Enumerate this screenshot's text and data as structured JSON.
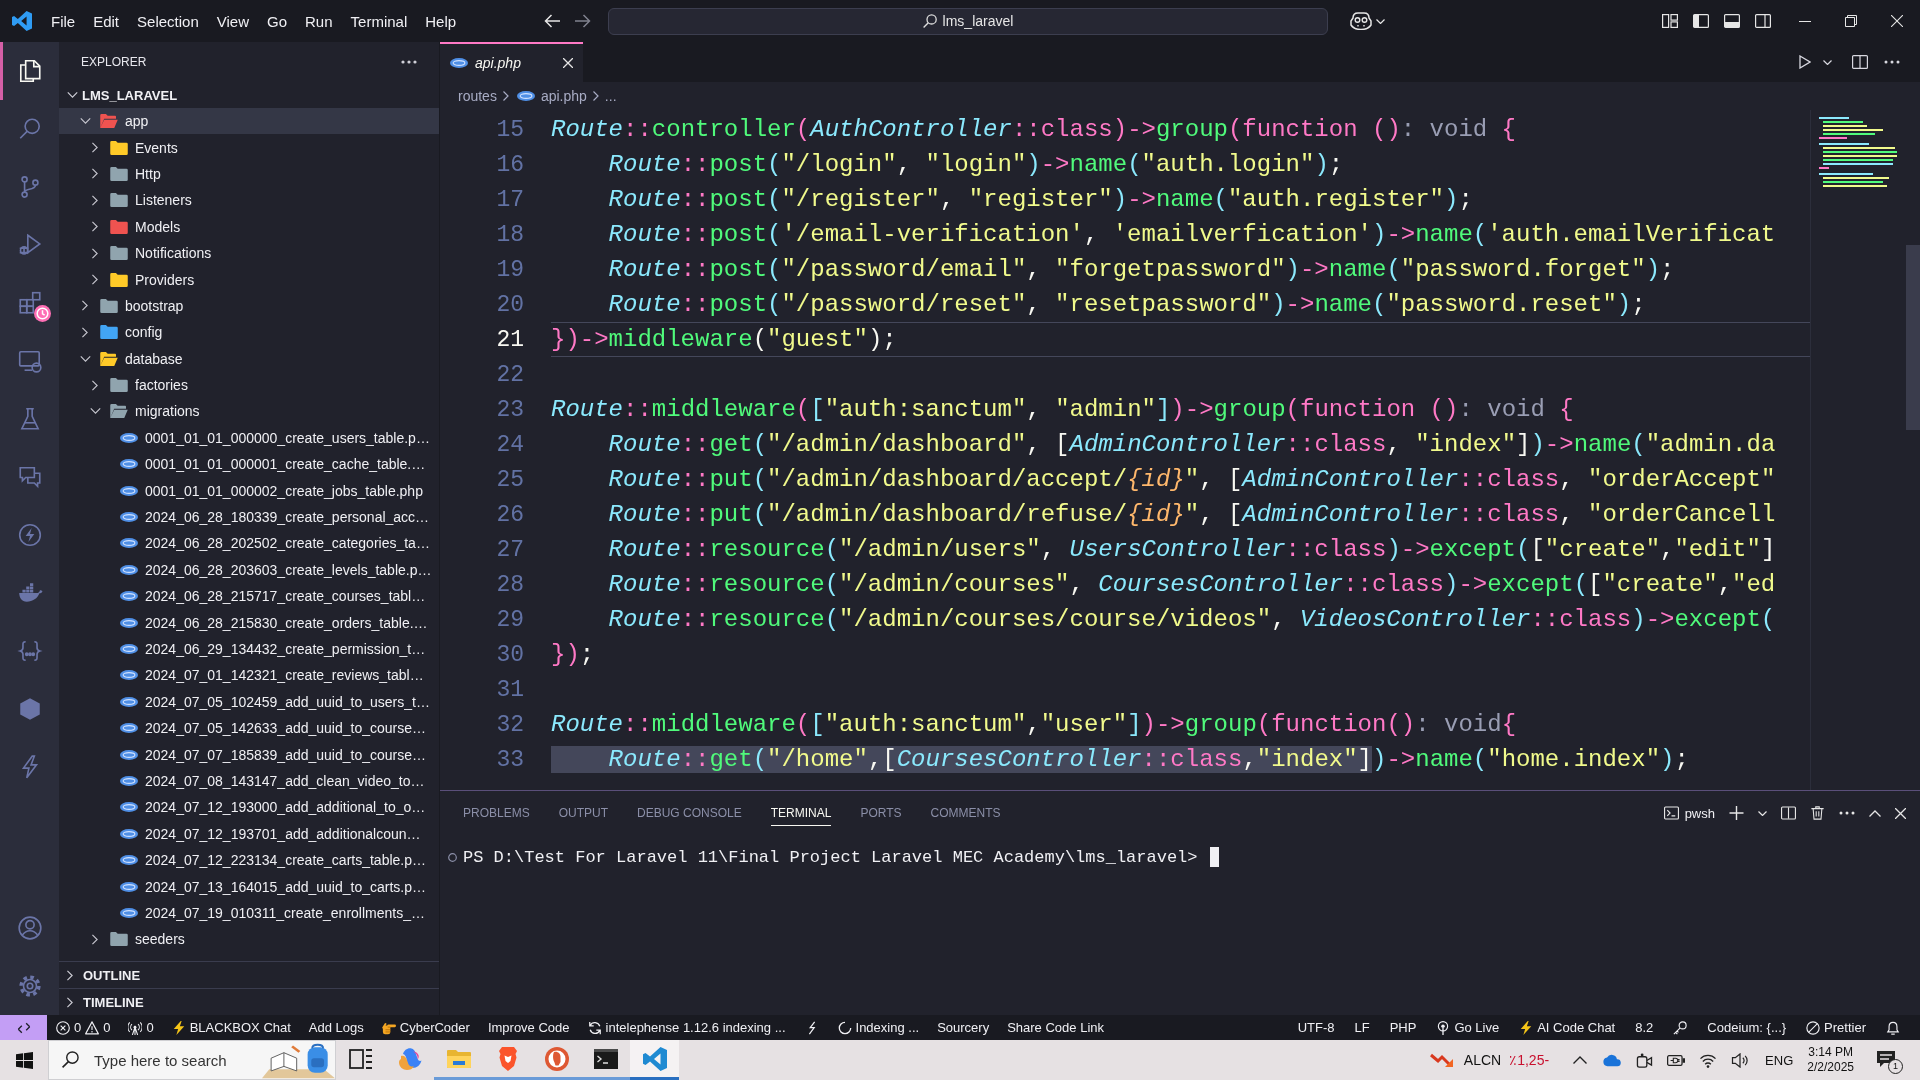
{
  "title_bar": {
    "menu": [
      "File",
      "Edit",
      "Selection",
      "View",
      "Go",
      "Run",
      "Terminal",
      "Help"
    ],
    "search": "lms_laravel",
    "layout_toggles": [
      {
        "kind": "primary-sidebar",
        "on": true
      },
      {
        "kind": "panel",
        "on": true
      },
      {
        "kind": "secondary-sidebar",
        "on": false
      }
    ]
  },
  "activity_bar": {
    "top": [
      {
        "kind": "explorer",
        "selected": true,
        "badge": false
      },
      {
        "kind": "search",
        "selected": false,
        "badge": false
      },
      {
        "kind": "source-control",
        "selected": false,
        "badge": false
      },
      {
        "kind": "run-debug",
        "selected": false,
        "badge": false
      },
      {
        "kind": "extensions",
        "selected": false,
        "badge": true
      },
      {
        "kind": "remote",
        "selected": false,
        "badge": false
      },
      {
        "kind": "testing",
        "selected": false,
        "badge": false
      },
      {
        "kind": "chat",
        "selected": false,
        "badge": false
      },
      {
        "kind": "bolt-circle",
        "selected": false,
        "badge": false
      },
      {
        "kind": "docker",
        "selected": false,
        "badge": false
      },
      {
        "kind": "braces",
        "selected": false,
        "badge": false
      },
      {
        "kind": "hexagon",
        "selected": false,
        "badge": false
      },
      {
        "kind": "bolt",
        "selected": false,
        "badge": false
      }
    ],
    "bottom": [
      {
        "kind": "account"
      },
      {
        "kind": "settings"
      }
    ]
  },
  "sidebar": {
    "title": "EXPLORER",
    "root": {
      "label": "LMS_LARAVEL",
      "expanded": true,
      "children": [
        {
          "label": "app",
          "kind": "folder",
          "color": "#ef5350",
          "expanded": true,
          "selected": true,
          "children": [
            {
              "label": "Events",
              "kind": "folder",
              "color": "#ffca28",
              "expanded": false,
              "selected": false
            },
            {
              "label": "Http",
              "kind": "folder",
              "color": "#90a4ae",
              "expanded": false,
              "selected": false
            },
            {
              "label": "Listeners",
              "kind": "folder",
              "color": "#90a4ae",
              "expanded": false,
              "selected": false
            },
            {
              "label": "Models",
              "kind": "folder",
              "color": "#ef5350",
              "expanded": false,
              "selected": false
            },
            {
              "label": "Notifications",
              "kind": "folder",
              "color": "#90a4ae",
              "expanded": false,
              "selected": false
            },
            {
              "label": "Providers",
              "kind": "folder",
              "color": "#ffca28",
              "expanded": false,
              "selected": false
            }
          ]
        },
        {
          "label": "bootstrap",
          "kind": "folder",
          "color": "#90a4ae",
          "expanded": false,
          "selected": false
        },
        {
          "label": "config",
          "kind": "folder",
          "color": "#42a5f5",
          "expanded": false,
          "selected": false
        },
        {
          "label": "database",
          "kind": "folder",
          "color": "#ffca28",
          "expanded": true,
          "selected": false,
          "children": [
            {
              "label": "factories",
              "kind": "folder",
              "color": "#90a4ae",
              "expanded": false,
              "selected": false
            },
            {
              "label": "migrations",
              "kind": "folder",
              "color": "#90a4ae",
              "expanded": true,
              "selected": false,
              "children": [
                {
                  "label": "0001_01_01_000000_create_users_table.p…",
                  "kind": "php",
                  "selected": false
                },
                {
                  "label": "0001_01_01_000001_create_cache_table.…",
                  "kind": "php",
                  "selected": false
                },
                {
                  "label": "0001_01_01_000002_create_jobs_table.php",
                  "kind": "php",
                  "selected": false
                },
                {
                  "label": "2024_06_28_180339_create_personal_acc…",
                  "kind": "php",
                  "selected": false
                },
                {
                  "label": "2024_06_28_202502_create_categories_ta…",
                  "kind": "php",
                  "selected": false
                },
                {
                  "label": "2024_06_28_203603_create_levels_table.p…",
                  "kind": "php",
                  "selected": false
                },
                {
                  "label": "2024_06_28_215717_create_courses_tabl…",
                  "kind": "php",
                  "selected": false
                },
                {
                  "label": "2024_06_28_215830_create_orders_table.…",
                  "kind": "php",
                  "selected": false
                },
                {
                  "label": "2024_06_29_134432_create_permission_t…",
                  "kind": "php",
                  "selected": false
                },
                {
                  "label": "2024_07_01_142321_create_reviews_tabl…",
                  "kind": "php",
                  "selected": false
                },
                {
                  "label": "2024_07_05_102459_add_uuid_to_users_t…",
                  "kind": "php",
                  "selected": false
                },
                {
                  "label": "2024_07_05_142633_add_uuid_to_course…",
                  "kind": "php",
                  "selected": false
                },
                {
                  "label": "2024_07_07_185839_add_uuid_to_course…",
                  "kind": "php",
                  "selected": false
                },
                {
                  "label": "2024_07_08_143147_add_clean_video_to…",
                  "kind": "php",
                  "selected": false
                },
                {
                  "label": "2024_07_12_193000_add_additional_to_o…",
                  "kind": "php",
                  "selected": false
                },
                {
                  "label": "2024_07_12_193701_add_additionalcoun…",
                  "kind": "php",
                  "selected": false
                },
                {
                  "label": "2024_07_12_223134_create_carts_table.p…",
                  "kind": "php",
                  "selected": false
                },
                {
                  "label": "2024_07_13_164015_add_uuid_to_carts.p…",
                  "kind": "php",
                  "selected": false
                },
                {
                  "label": "2024_07_19_010311_create_enrollments_…",
                  "kind": "php",
                  "selected": false
                }
              ]
            },
            {
              "label": "seeders",
              "kind": "folder",
              "color": "#90a4ae",
              "expanded": false,
              "selected": false
            }
          ]
        }
      ]
    },
    "sections": [
      {
        "label": "OUTLINE",
        "expanded": false
      },
      {
        "label": "TIMELINE",
        "expanded": false
      }
    ]
  },
  "editor": {
    "tabs": [
      {
        "label": "api.php",
        "selected": true,
        "preview": true
      }
    ],
    "breadcrumb": [
      {
        "label": "routes",
        "kind": "folder"
      },
      {
        "label": "api.php",
        "kind": "php"
      },
      {
        "label": "...",
        "kind": "more"
      }
    ],
    "lines": [
      {
        "number": "15",
        "current": false,
        "tokens": [
          {
            "text": "Route",
            "kind": "class"
          },
          {
            "text": "::",
            "kind": "keyword"
          },
          {
            "text": "controller",
            "kind": "function"
          },
          {
            "text": "(",
            "kind": "keyword"
          },
          {
            "text": "AuthController",
            "kind": "class"
          },
          {
            "text": "::class)->",
            "kind": "keyword"
          },
          {
            "text": "group",
            "kind": "function"
          },
          {
            "text": "(function ()",
            "kind": "keyword"
          },
          {
            "text": ": void ",
            "kind": "type"
          },
          {
            "text": "{",
            "kind": "keyword"
          }
        ]
      },
      {
        "number": "16",
        "current": false,
        "tokens": [
          {
            "text": "    Route",
            "kind": "class"
          },
          {
            "text": "::",
            "kind": "keyword"
          },
          {
            "text": "post",
            "kind": "function"
          },
          {
            "text": "(",
            "kind": "bracket"
          },
          {
            "text": "\"/login\"",
            "kind": "string"
          },
          {
            "text": ", ",
            "kind": "plain"
          },
          {
            "text": "\"login\"",
            "kind": "string"
          },
          {
            "text": ")",
            "kind": "bracket"
          },
          {
            "text": "->",
            "kind": "keyword"
          },
          {
            "text": "name",
            "kind": "function"
          },
          {
            "text": "(",
            "kind": "bracket"
          },
          {
            "text": "\"auth.login\"",
            "kind": "string"
          },
          {
            "text": ")",
            "kind": "bracket"
          },
          {
            "text": ";",
            "kind": "plain"
          }
        ]
      },
      {
        "number": "17",
        "current": false,
        "tokens": [
          {
            "text": "    Route",
            "kind": "class"
          },
          {
            "text": "::",
            "kind": "keyword"
          },
          {
            "text": "post",
            "kind": "function"
          },
          {
            "text": "(",
            "kind": "bracket"
          },
          {
            "text": "\"/register\"",
            "kind": "string"
          },
          {
            "text": ", ",
            "kind": "plain"
          },
          {
            "text": "\"register\"",
            "kind": "string"
          },
          {
            "text": ")",
            "kind": "bracket"
          },
          {
            "text": "->",
            "kind": "keyword"
          },
          {
            "text": "name",
            "kind": "function"
          },
          {
            "text": "(",
            "kind": "bracket"
          },
          {
            "text": "\"auth.register\"",
            "kind": "string"
          },
          {
            "text": ")",
            "kind": "bracket"
          },
          {
            "text": ";",
            "kind": "plain"
          }
        ]
      },
      {
        "number": "18",
        "current": false,
        "tokens": [
          {
            "text": "    Route",
            "kind": "class"
          },
          {
            "text": "::",
            "kind": "keyword"
          },
          {
            "text": "post",
            "kind": "function"
          },
          {
            "text": "(",
            "kind": "bracket"
          },
          {
            "text": "'/email-verification'",
            "kind": "string"
          },
          {
            "text": ", ",
            "kind": "plain"
          },
          {
            "text": "'emailverfication'",
            "kind": "string"
          },
          {
            "text": ")",
            "kind": "bracket"
          },
          {
            "text": "->",
            "kind": "keyword"
          },
          {
            "text": "name",
            "kind": "function"
          },
          {
            "text": "(",
            "kind": "bracket"
          },
          {
            "text": "'auth.emailVerificat",
            "kind": "string"
          }
        ]
      },
      {
        "number": "19",
        "current": false,
        "tokens": [
          {
            "text": "    Route",
            "kind": "class"
          },
          {
            "text": "::",
            "kind": "keyword"
          },
          {
            "text": "post",
            "kind": "function"
          },
          {
            "text": "(",
            "kind": "bracket"
          },
          {
            "text": "\"/password/email\"",
            "kind": "string"
          },
          {
            "text": ", ",
            "kind": "plain"
          },
          {
            "text": "\"forgetpassword\"",
            "kind": "string"
          },
          {
            "text": ")",
            "kind": "bracket"
          },
          {
            "text": "->",
            "kind": "keyword"
          },
          {
            "text": "name",
            "kind": "function"
          },
          {
            "text": "(",
            "kind": "bracket"
          },
          {
            "text": "\"password.forget\"",
            "kind": "string"
          },
          {
            "text": ")",
            "kind": "bracket"
          },
          {
            "text": ";",
            "kind": "plain"
          }
        ]
      },
      {
        "number": "20",
        "current": false,
        "tokens": [
          {
            "text": "    Route",
            "kind": "class"
          },
          {
            "text": "::",
            "kind": "keyword"
          },
          {
            "text": "post",
            "kind": "function"
          },
          {
            "text": "(",
            "kind": "bracket"
          },
          {
            "text": "\"/password/reset\"",
            "kind": "string"
          },
          {
            "text": ", ",
            "kind": "plain"
          },
          {
            "text": "\"resetpassword\"",
            "kind": "string"
          },
          {
            "text": ")",
            "kind": "bracket"
          },
          {
            "text": "->",
            "kind": "keyword"
          },
          {
            "text": "name",
            "kind": "function"
          },
          {
            "text": "(",
            "kind": "bracket"
          },
          {
            "text": "\"password.reset\"",
            "kind": "string"
          },
          {
            "text": ")",
            "kind": "bracket"
          },
          {
            "text": ";",
            "kind": "plain"
          }
        ]
      },
      {
        "number": "21",
        "current": true,
        "tokens": [
          {
            "text": "})->",
            "kind": "keyword"
          },
          {
            "text": "middleware",
            "kind": "function"
          },
          {
            "text": "(",
            "kind": "plain"
          },
          {
            "text": "\"guest\"",
            "kind": "string"
          },
          {
            "text": ");",
            "kind": "plain"
          }
        ]
      },
      {
        "number": "22",
        "current": false
      },
      {
        "number": "23",
        "current": false,
        "tokens": [
          {
            "text": "Route",
            "kind": "class"
          },
          {
            "text": "::",
            "kind": "keyword"
          },
          {
            "text": "middleware",
            "kind": "function"
          },
          {
            "text": "(",
            "kind": "keyword"
          },
          {
            "text": "[",
            "kind": "bracket"
          },
          {
            "text": "\"auth:sanctum\"",
            "kind": "string"
          },
          {
            "text": ", ",
            "kind": "plain"
          },
          {
            "text": "\"admin\"",
            "kind": "string"
          },
          {
            "text": "]",
            "kind": "bracket"
          },
          {
            "text": ")->",
            "kind": "keyword"
          },
          {
            "text": "group",
            "kind": "function"
          },
          {
            "text": "(function ()",
            "kind": "keyword"
          },
          {
            "text": ": void ",
            "kind": "type"
          },
          {
            "text": "{",
            "kind": "keyword"
          }
        ]
      },
      {
        "number": "24",
        "current": false,
        "tokens": [
          {
            "text": "    Route",
            "kind": "class"
          },
          {
            "text": "::",
            "kind": "keyword"
          },
          {
            "text": "get",
            "kind": "function"
          },
          {
            "text": "(",
            "kind": "bracket"
          },
          {
            "text": "\"/admin/dashboard\"",
            "kind": "string"
          },
          {
            "text": ", [",
            "kind": "plain"
          },
          {
            "text": "AdminController",
            "kind": "class"
          },
          {
            "text": "::class",
            "kind": "keyword"
          },
          {
            "text": ", ",
            "kind": "plain"
          },
          {
            "text": "\"index\"",
            "kind": "string"
          },
          {
            "text": "]",
            "kind": "plain"
          },
          {
            "text": ")",
            "kind": "bracket"
          },
          {
            "text": "->",
            "kind": "keyword"
          },
          {
            "text": "name",
            "kind": "function"
          },
          {
            "text": "(",
            "kind": "bracket"
          },
          {
            "text": "\"admin.da",
            "kind": "string"
          }
        ]
      },
      {
        "number": "25",
        "current": false,
        "tokens": [
          {
            "text": "    Route",
            "kind": "class"
          },
          {
            "text": "::",
            "kind": "keyword"
          },
          {
            "text": "put",
            "kind": "function"
          },
          {
            "text": "(",
            "kind": "bracket"
          },
          {
            "text": "\"/admin/dashboard/accept/",
            "kind": "string"
          },
          {
            "text": "{id}",
            "kind": "variable"
          },
          {
            "text": "\"",
            "kind": "string"
          },
          {
            "text": ", [",
            "kind": "plain"
          },
          {
            "text": "AdminController",
            "kind": "class"
          },
          {
            "text": "::class",
            "kind": "keyword"
          },
          {
            "text": ", ",
            "kind": "plain"
          },
          {
            "text": "\"orderAccept\"",
            "kind": "string"
          }
        ]
      },
      {
        "number": "26",
        "current": false,
        "tokens": [
          {
            "text": "    Route",
            "kind": "class"
          },
          {
            "text": "::",
            "kind": "keyword"
          },
          {
            "text": "put",
            "kind": "function"
          },
          {
            "text": "(",
            "kind": "bracket"
          },
          {
            "text": "\"/admin/dashboard/refuse/",
            "kind": "string"
          },
          {
            "text": "{id}",
            "kind": "variable"
          },
          {
            "text": "\"",
            "kind": "string"
          },
          {
            "text": ", [",
            "kind": "plain"
          },
          {
            "text": "AdminController",
            "kind": "class"
          },
          {
            "text": "::class",
            "kind": "keyword"
          },
          {
            "text": ", ",
            "kind": "plain"
          },
          {
            "text": "\"orderCancell",
            "kind": "string"
          }
        ]
      },
      {
        "number": "27",
        "current": false,
        "tokens": [
          {
            "text": "    Route",
            "kind": "class"
          },
          {
            "text": "::",
            "kind": "keyword"
          },
          {
            "text": "resource",
            "kind": "function"
          },
          {
            "text": "(",
            "kind": "bracket"
          },
          {
            "text": "\"/admin/users\"",
            "kind": "string"
          },
          {
            "text": ", ",
            "kind": "plain"
          },
          {
            "text": "UsersController",
            "kind": "class"
          },
          {
            "text": "::class",
            "kind": "keyword"
          },
          {
            "text": ")",
            "kind": "bracket"
          },
          {
            "text": "->",
            "kind": "keyword"
          },
          {
            "text": "except",
            "kind": "function"
          },
          {
            "text": "(",
            "kind": "bracket"
          },
          {
            "text": "[",
            "kind": "plain"
          },
          {
            "text": "\"create\"",
            "kind": "string"
          },
          {
            "text": ",",
            "kind": "plain"
          },
          {
            "text": "\"edit\"",
            "kind": "string"
          },
          {
            "text": "]",
            "kind": "plain"
          }
        ]
      },
      {
        "number": "28",
        "current": false,
        "tokens": [
          {
            "text": "    Route",
            "kind": "class"
          },
          {
            "text": "::",
            "kind": "keyword"
          },
          {
            "text": "resource",
            "kind": "function"
          },
          {
            "text": "(",
            "kind": "bracket"
          },
          {
            "text": "\"/admin/courses\"",
            "kind": "string"
          },
          {
            "text": ", ",
            "kind": "plain"
          },
          {
            "text": "CoursesController",
            "kind": "class"
          },
          {
            "text": "::class",
            "kind": "keyword"
          },
          {
            "text": ")",
            "kind": "bracket"
          },
          {
            "text": "->",
            "kind": "keyword"
          },
          {
            "text": "except",
            "kind": "function"
          },
          {
            "text": "(",
            "kind": "bracket"
          },
          {
            "text": "[",
            "kind": "plain"
          },
          {
            "text": "\"create\"",
            "kind": "string"
          },
          {
            "text": ",",
            "kind": "plain"
          },
          {
            "text": "\"ed",
            "kind": "string"
          }
        ]
      },
      {
        "number": "29",
        "current": false,
        "tokens": [
          {
            "text": "    Route",
            "kind": "class"
          },
          {
            "text": "::",
            "kind": "keyword"
          },
          {
            "text": "resource",
            "kind": "function"
          },
          {
            "text": "(",
            "kind": "bracket"
          },
          {
            "text": "\"/admin/courses/course/videos\"",
            "kind": "string"
          },
          {
            "text": ", ",
            "kind": "plain"
          },
          {
            "text": "VideosController",
            "kind": "class"
          },
          {
            "text": "::class",
            "kind": "keyword"
          },
          {
            "text": ")",
            "kind": "bracket"
          },
          {
            "text": "->",
            "kind": "keyword"
          },
          {
            "text": "except",
            "kind": "function"
          },
          {
            "text": "(",
            "kind": "bracket"
          }
        ]
      },
      {
        "number": "30",
        "current": false,
        "tokens": [
          {
            "text": "})",
            "kind": "keyword"
          },
          {
            "text": ";",
            "kind": "plain"
          }
        ]
      },
      {
        "number": "31",
        "current": false
      },
      {
        "number": "32",
        "current": false,
        "tokens": [
          {
            "text": "Route",
            "kind": "class"
          },
          {
            "text": "::",
            "kind": "keyword"
          },
          {
            "text": "middleware",
            "kind": "function"
          },
          {
            "text": "(",
            "kind": "keyword"
          },
          {
            "text": "[",
            "kind": "bracket"
          },
          {
            "text": "\"auth:sanctum\"",
            "kind": "string"
          },
          {
            "text": ",",
            "kind": "plain"
          },
          {
            "text": "\"user\"",
            "kind": "string"
          },
          {
            "text": "]",
            "kind": "bracket"
          },
          {
            "text": ")->",
            "kind": "keyword"
          },
          {
            "text": "group",
            "kind": "function"
          },
          {
            "text": "(function()",
            "kind": "keyword"
          },
          {
            "text": ": void",
            "kind": "type"
          },
          {
            "text": "{",
            "kind": "keyword"
          }
        ]
      },
      {
        "number": "33",
        "current": false,
        "selection": [
          {
            "text": "    Route",
            "kind": "class"
          },
          {
            "text": "::",
            "kind": "keyword"
          },
          {
            "text": "get",
            "kind": "function"
          },
          {
            "text": "(",
            "kind": "bracket"
          },
          {
            "text": "\"/home\"",
            "kind": "string"
          },
          {
            "text": ",[",
            "kind": "plain"
          },
          {
            "text": "CoursesController",
            "kind": "class"
          },
          {
            "text": "::class",
            "kind": "keyword"
          },
          {
            "text": ",",
            "kind": "plain"
          },
          {
            "text": "\"index\"",
            "kind": "string"
          },
          {
            "text": "]",
            "kind": "plain"
          }
        ],
        "tokens": [
          {
            "text": ")",
            "kind": "bracket"
          },
          {
            "text": "->",
            "kind": "keyword"
          },
          {
            "text": "name",
            "kind": "function"
          },
          {
            "text": "(",
            "kind": "bracket"
          },
          {
            "text": "\"home.index\"",
            "kind": "string"
          },
          {
            "text": ")",
            "kind": "bracket"
          },
          {
            "text": ";",
            "kind": "plain"
          }
        ]
      }
    ]
  },
  "panel": {
    "tabs": [
      {
        "label": "PROBLEMS",
        "selected": false
      },
      {
        "label": "OUTPUT",
        "selected": false
      },
      {
        "label": "DEBUG CONSOLE",
        "selected": false
      },
      {
        "label": "TERMINAL",
        "selected": true
      },
      {
        "label": "PORTS",
        "selected": false
      },
      {
        "label": "COMMENTS",
        "selected": false
      }
    ],
    "shell": "pwsh",
    "terminal": {
      "prompt": "PS D:\\Test For Laravel 11\\Final Project Laravel MEC Academy\\lms_laravel>"
    }
  },
  "status_bar": {
    "left": [
      {
        "kind": "remote"
      },
      {
        "kind": "problems",
        "errors": "0",
        "warnings": "0"
      },
      {
        "kind": "ports",
        "text": "0"
      },
      {
        "kind": "bolt",
        "text": "BLACKBOX Chat"
      },
      {
        "kind": "plain",
        "text": "Add Logs"
      },
      {
        "kind": "hand",
        "text": "CyberCoder"
      },
      {
        "kind": "plain",
        "text": "Improve Code"
      },
      {
        "kind": "sync",
        "text": "intelephense 1.12.6 indexing ..."
      },
      {
        "kind": "squiggle"
      },
      {
        "kind": "spinner",
        "text": "Indexing ..."
      },
      {
        "kind": "plain",
        "text": "Sourcery"
      },
      {
        "kind": "plain",
        "text": "Share Code Link"
      }
    ],
    "right": [
      {
        "kind": "plain",
        "text": "UTF-8"
      },
      {
        "kind": "plain",
        "text": "LF"
      },
      {
        "kind": "plain",
        "text": "PHP"
      },
      {
        "kind": "broadcast",
        "text": "Go Live"
      },
      {
        "kind": "bolt",
        "text": "AI Code Chat"
      },
      {
        "kind": "plain",
        "text": "8.2"
      },
      {
        "kind": "key"
      },
      {
        "kind": "plain",
        "text": "Codeium: {...}"
      },
      {
        "kind": "blocked",
        "text": "Prettier"
      },
      {
        "kind": "bell"
      }
    ]
  },
  "taskbar": {
    "search": {
      "placeholder": "Type here to search"
    },
    "apps": [
      {
        "kind": "task-view",
        "running": false,
        "active": false
      },
      {
        "kind": "copilot",
        "running": false,
        "active": false
      },
      {
        "kind": "file-explorer",
        "running": true,
        "active": false
      },
      {
        "kind": "brave",
        "running": true,
        "active": false
      },
      {
        "kind": "duckduckgo",
        "running": true,
        "active": false
      },
      {
        "kind": "terminal",
        "running": true,
        "active": false
      },
      {
        "kind": "vscode",
        "running": true,
        "active": true
      }
    ],
    "stock": {
      "symbol": "ALCN",
      "change": "٪1,25-"
    },
    "tray": {
      "language": "ENG",
      "time": "3:14 PM",
      "date": "2/2/2025",
      "notifications": "1"
    }
  }
}
